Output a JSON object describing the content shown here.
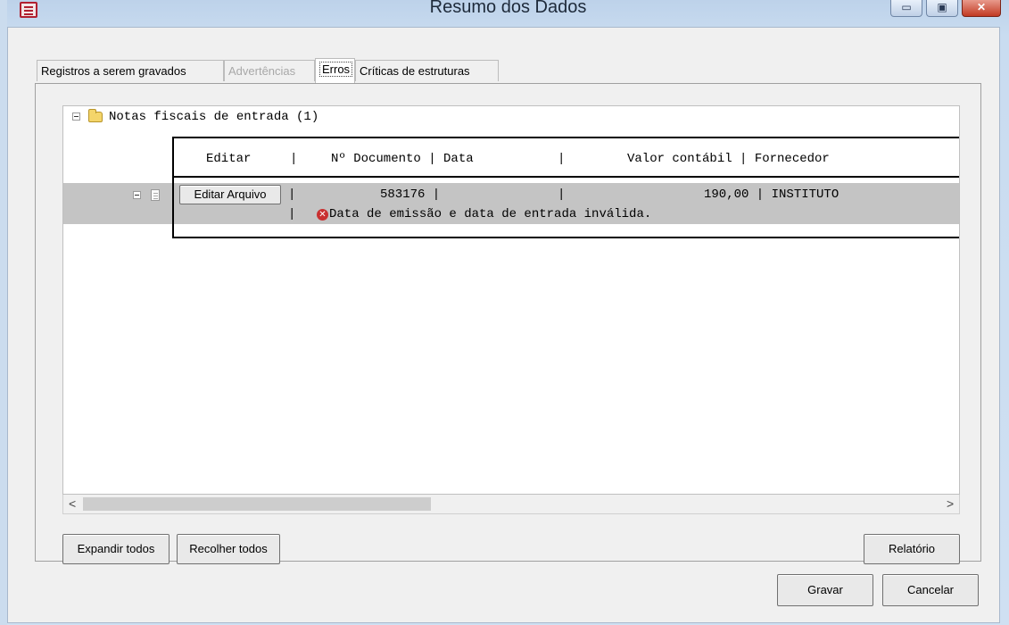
{
  "window": {
    "title": "Resumo dos Dados",
    "controls": {
      "minimize": "▭",
      "maximize": "▣",
      "close": "✕"
    }
  },
  "tabs": [
    {
      "label": "Registros a serem gravados",
      "state": "normal"
    },
    {
      "label": "Advertências",
      "state": "disabled"
    },
    {
      "label": "Erros",
      "state": "selected"
    },
    {
      "label": "Críticas de estruturas",
      "state": "normal"
    }
  ],
  "tree": {
    "group_label": "Notas fiscais de entrada (1)",
    "header": {
      "editar": "Editar",
      "sep1": "|",
      "doc": "Nº Documento | Data",
      "sep2": "|",
      "valor": "Valor contábil | Fornecedor"
    },
    "row": {
      "edit_button": "Editar Arquivo",
      "sep1": "|",
      "doc": "583176 |",
      "sep2": "|",
      "valor": "190,00 | INSTITUTO",
      "error_sep": "|",
      "error_message": "Data de emissão e data de entrada inválida."
    },
    "error_icon": "error-circle-icon"
  },
  "scrollbar": {
    "left_arrow": "<",
    "right_arrow": ">"
  },
  "buttons": {
    "expand_all": "Expandir todos",
    "collapse_all": "Recolher todos",
    "report": "Relatório",
    "save": "Gravar",
    "cancel": "Cancelar"
  },
  "colors": {
    "row_highlight": "#c4c4c4",
    "error_icon": "#c93030",
    "folder": "#f4d56a"
  }
}
